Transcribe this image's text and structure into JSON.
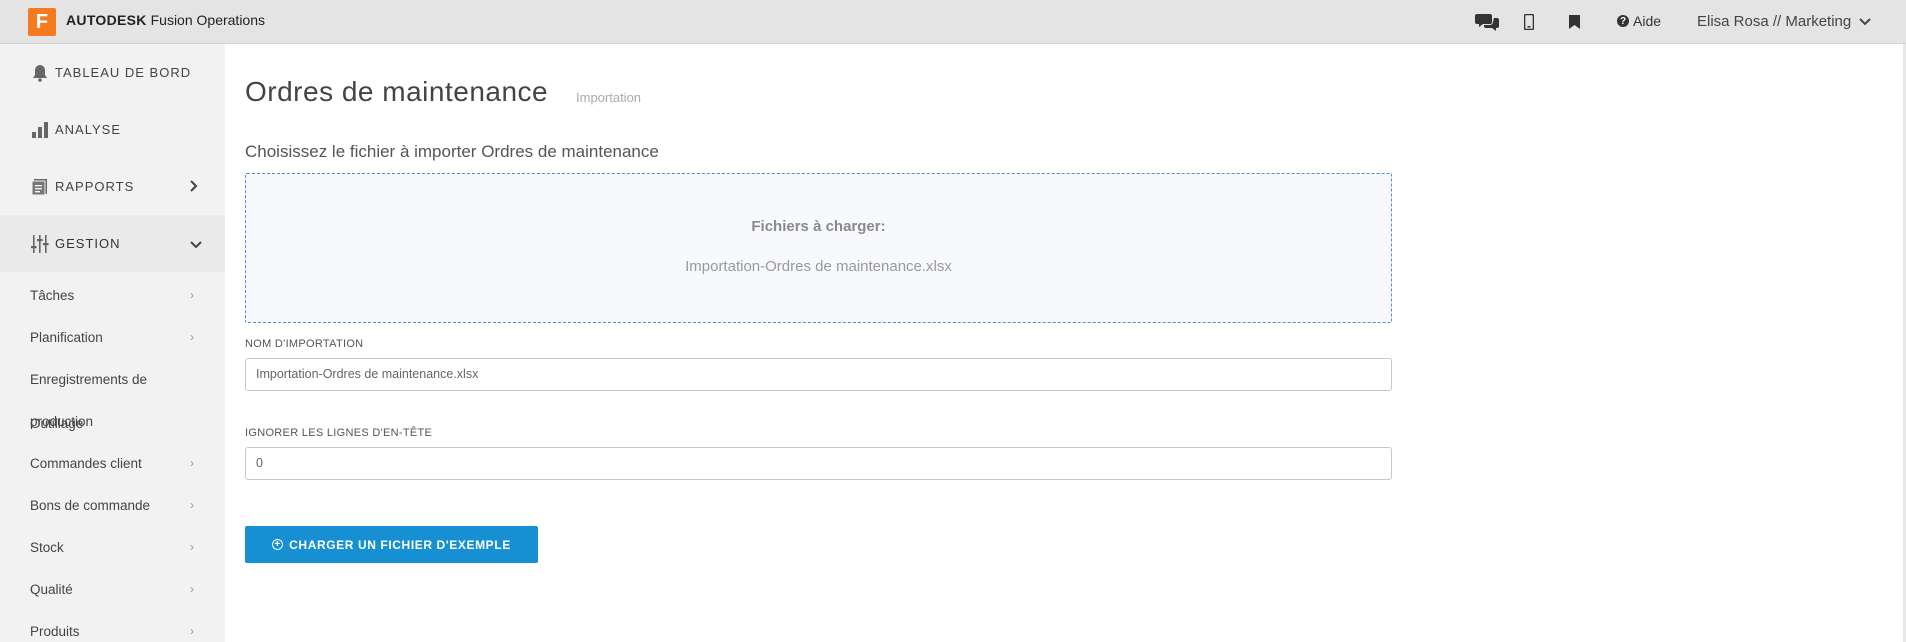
{
  "header": {
    "logo_letter": "F",
    "brand_bold": "AUTODESK",
    "brand_rest": " Fusion Operations",
    "help_label": "Aide",
    "user_label": "Elisa Rosa // Marketing",
    "accent_color": "#f47b20"
  },
  "sidebar": {
    "main_items": [
      {
        "label": "TABLEAU DE BORD",
        "icon": "bell-icon"
      },
      {
        "label": "ANALYSE",
        "icon": "bar-chart-icon"
      },
      {
        "label": "RAPPORTS",
        "icon": "report-icon"
      },
      {
        "label": "GESTION",
        "icon": "sliders-icon"
      }
    ],
    "sub_items": [
      {
        "label": "Tâches"
      },
      {
        "label": "Planification"
      },
      {
        "label": "Enregistrements de"
      },
      {
        "label": "production"
      },
      {
        "label": "Outillage"
      },
      {
        "label": "Commandes client"
      },
      {
        "label": "Bons de commande"
      },
      {
        "label": "Stock"
      },
      {
        "label": "Qualité"
      },
      {
        "label": "Produits"
      }
    ]
  },
  "main": {
    "title": "Ordres de maintenance",
    "subtitle": "Importation",
    "choose_text": "Choisissez le fichier à importer Ordres de maintenance",
    "dropzone": {
      "title": "Fichiers à charger:",
      "file": "Importation-Ordres de maintenance.xlsx"
    },
    "import_name": {
      "label": "NOM D'IMPORTATION",
      "value": "Importation-Ordres de maintenance.xlsx"
    },
    "ignore_header": {
      "label": "IGNORER LES LIGNES D'EN-TÊTE",
      "value": "0"
    },
    "sample_button": "CHARGER UN FICHIER D'EXEMPLE",
    "button_color": "#1690d2"
  }
}
